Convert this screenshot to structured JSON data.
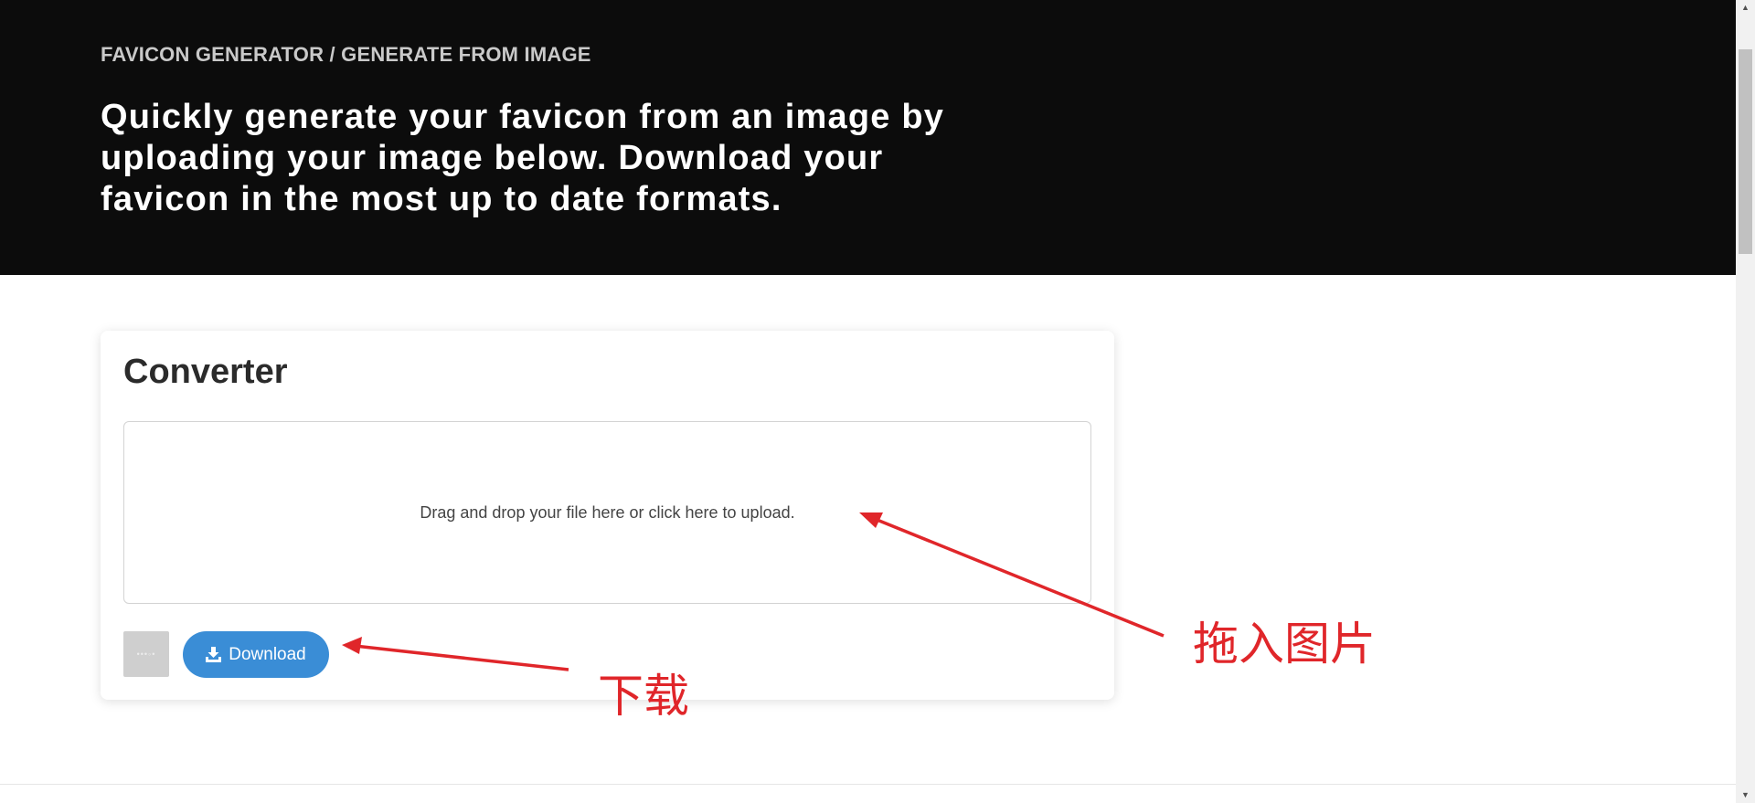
{
  "hero": {
    "breadcrumb": "FAVICON GENERATOR / GENERATE FROM IMAGE",
    "headline": "Quickly generate your favicon from an image by uploading your image below. Download your favicon in the most up to date formats."
  },
  "converter": {
    "title": "Converter",
    "dropzone_text": "Drag and drop your file here or click here to upload.",
    "download_label": "Download",
    "download_icon": "download-icon",
    "thumbnail_icon": "image-placeholder-icon"
  },
  "annotations": {
    "upload_label": "拖入图片",
    "download_label": "下载",
    "color": "#e0262a"
  },
  "colors": {
    "hero_bg": "#0c0c0c",
    "accent": "#3a8dd6"
  }
}
